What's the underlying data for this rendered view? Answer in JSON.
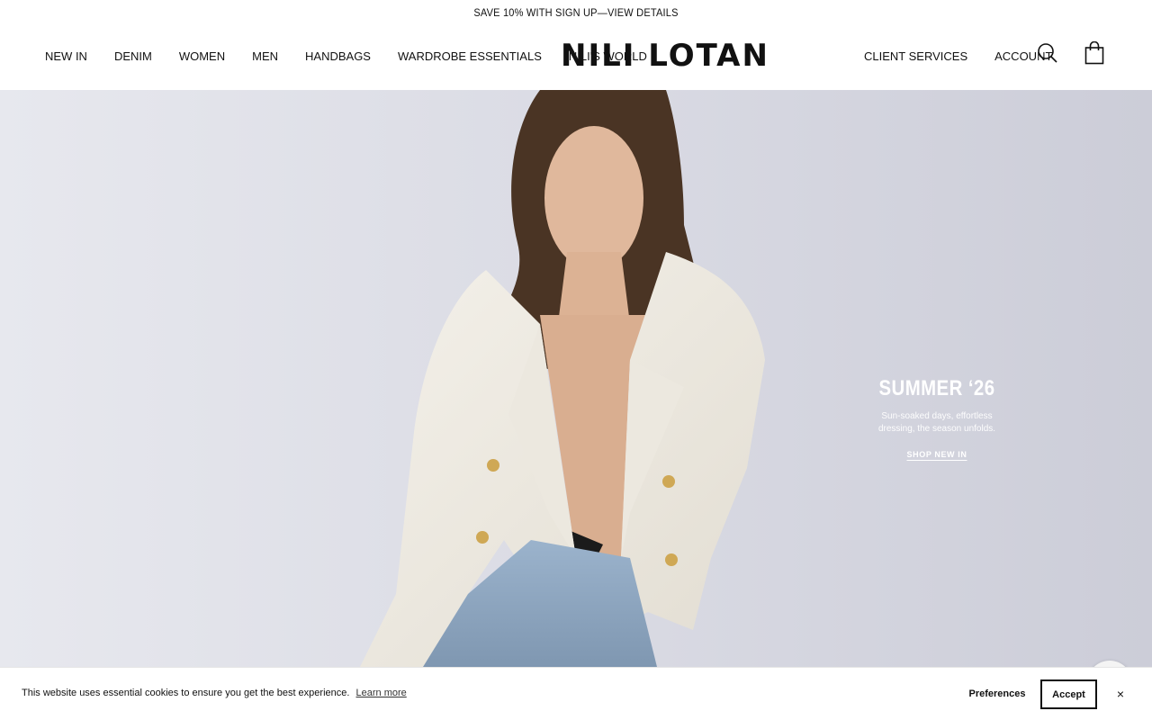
{
  "promo": {
    "text": "SAVE 10% WITH SIGN UP—VIEW DETAILS"
  },
  "nav": {
    "left": [
      "NEW IN",
      "DENIM",
      "WOMEN",
      "MEN",
      "HANDBAGS",
      "WARDROBE ESSENTIALS",
      "NILI'S WORLD"
    ],
    "right": [
      "CLIENT SERVICES",
      "ACCOUNT"
    ]
  },
  "brand": {
    "logo_text": "NILI LOTAN"
  },
  "icons": {
    "search": "search-icon",
    "cart": "shopping-bag-icon",
    "chat": "chat-icon",
    "close": "close-icon"
  },
  "hero": {
    "title": "SUMMER ‘26",
    "subtitle_line1": "Sun-soaked days, effortless",
    "subtitle_line2": "dressing, the season unfolds.",
    "cta": "SHOP NEW IN"
  },
  "cookie": {
    "message": "This website uses essential cookies to ensure you get the best experience.",
    "learn_more": "Learn more",
    "preferences": "Preferences",
    "accept": "Accept",
    "close": "×"
  },
  "colors": {
    "text": "#111111",
    "background": "#ffffff",
    "hero_bg": "#d9dae3",
    "hero_text": "#ffffff"
  }
}
